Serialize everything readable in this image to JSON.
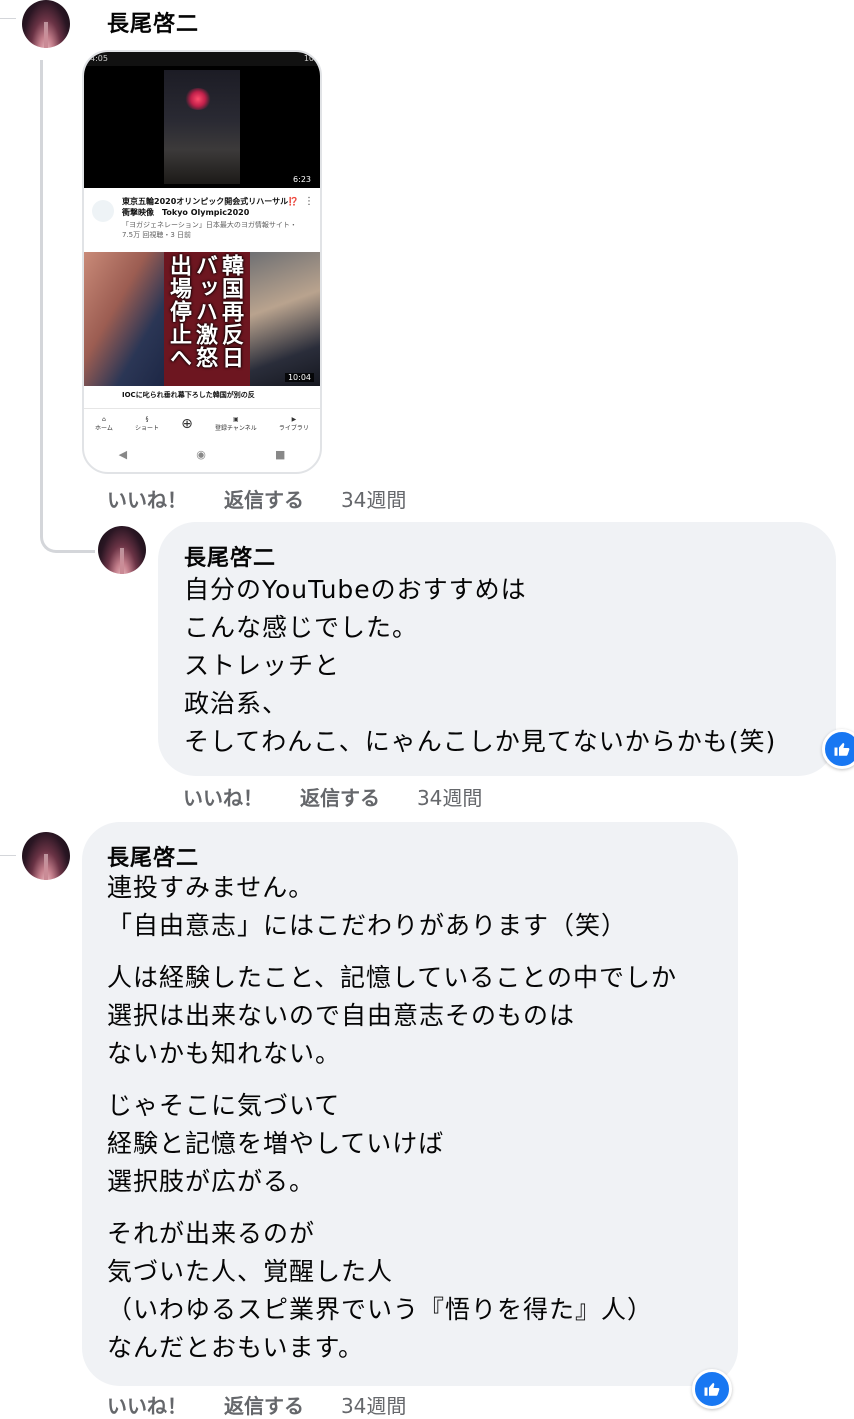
{
  "colors": {
    "like_blue": "#1877f2",
    "bubble_bg": "#f0f2f5",
    "meta_gray": "#65676b"
  },
  "comment1": {
    "author": "長尾啓二",
    "attachment": {
      "status_left": "4:05",
      "status_right": "10",
      "video1_duration": "6:23",
      "video1_title": "東京五輪2020オリンピック開会式リハーサル⁉️ 衝撃映像　Tokyo Olympic2020",
      "video1_meta": "「ヨガジェネレーション」日本最大のヨガ情報サイト・7.5万 回視聴・3 日前",
      "video2_overlay_right": "韓国再反日",
      "video2_overlay_mid": "バッハ激怒",
      "video2_overlay_left": "出場停止へ",
      "video2_duration": "10:04",
      "video2_title": "IOCに叱られ垂れ幕下ろした韓国が別の反",
      "nav": [
        "ホーム",
        "ショート",
        "",
        "登録チャンネル",
        "ライブラリ"
      ]
    },
    "actions": {
      "like": "いいね！",
      "reply": "返信する",
      "time": "34週間"
    }
  },
  "reply1": {
    "author": "長尾啓二",
    "lines": [
      "自分のYouTubeのおすすめは",
      "こんな感じでした。",
      "ストレッチと",
      "政治系、",
      "そしてわんこ、にゃんこしか見てないからかも(笑)"
    ],
    "actions": {
      "like": "いいね！",
      "reply": "返信する",
      "time": "34週間"
    }
  },
  "comment2": {
    "author": "長尾啓二",
    "paragraphs": [
      [
        "連投すみません。",
        "「自由意志」にはこだわりがあります（笑）"
      ],
      [
        "人は経験したこと、記憶していることの中でしか",
        "選択は出来ないので自由意志そのものは",
        "ないかも知れない。"
      ],
      [
        "じゃそこに気づいて",
        "経験と記憶を増やしていけば",
        "選択肢が広がる。"
      ],
      [
        "それが出来るのが",
        "気づいた人、覚醒した人",
        "（いわゆるスピ業界でいう『悟りを得た』人）",
        "なんだとおもいます。"
      ]
    ],
    "actions": {
      "like": "いいね！",
      "reply": "返信する",
      "time": "34週間"
    }
  }
}
